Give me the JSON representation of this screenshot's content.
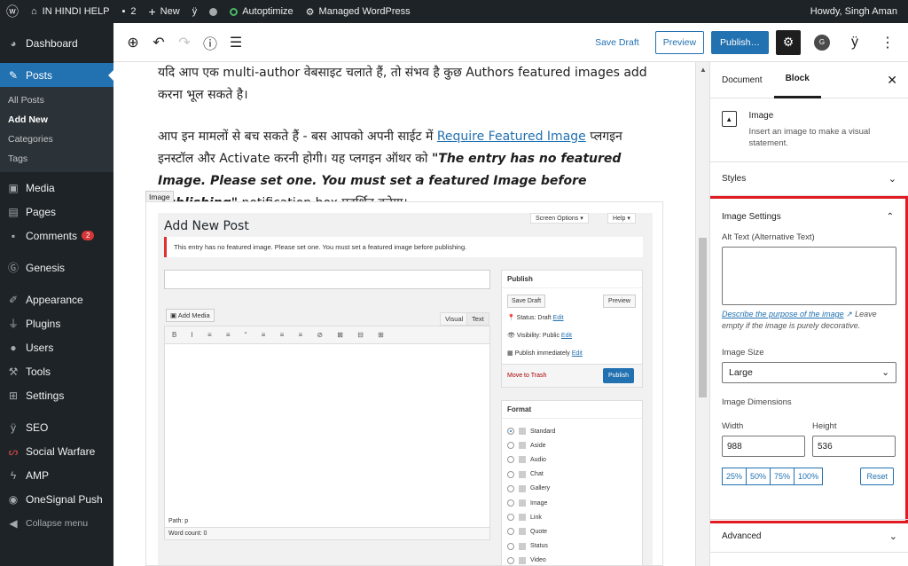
{
  "adminbar": {
    "site_name": "IN HINDI HELP",
    "comments_count": "2",
    "new_label": "New",
    "autoptimize": "Autoptimize",
    "managed": "Managed WordPress",
    "howdy": "Howdy, Singh Aman"
  },
  "sidebar": {
    "dashboard": "Dashboard",
    "posts": "Posts",
    "sub": [
      "All Posts",
      "Add New",
      "Categories",
      "Tags"
    ],
    "media": "Media",
    "pages": "Pages",
    "comments": "Comments",
    "comments_badge": "2",
    "genesis": "Genesis",
    "appearance": "Appearance",
    "plugins": "Plugins",
    "users": "Users",
    "tools": "Tools",
    "settings": "Settings",
    "seo": "SEO",
    "social_warfare": "Social Warfare",
    "amp": "AMP",
    "onesignal": "OneSignal Push",
    "collapse": "Collapse menu"
  },
  "toolbar": {
    "save_draft": "Save Draft",
    "preview": "Preview",
    "publish": "Publish…"
  },
  "editor": {
    "para1": "यदि आप एक multi-author वेबसाइट चलाते हैं, तो संभव है कुछ Authors featured images add करना भूल सकते है।",
    "para2_a": "आप इन मामलों से बच सकते हैं - बस आपको अपनी साईट में ",
    "para2_link": "Require Featured Image",
    "para2_b": " प्लगइन इनस्टॉल और Activate करनी होगी। यह प्लगइन ऑथर को ",
    "para2_quote": "\"The entry has no featured Image. Please set one. You must set a featured Image before publishing\"",
    "para2_c": " notification box प्रदर्शित करेगा।",
    "image_label": "Image"
  },
  "screenshot": {
    "title": "Add New Post",
    "screen_options": "Screen Options",
    "help": "Help",
    "notice": "This entry has no featured image. Please set one. You must set a featured image before publishing.",
    "add_media": "Add Media",
    "visual": "Visual",
    "text": "Text",
    "path": "Path: p",
    "word_count": "Word count: 0",
    "publish_box": "Publish",
    "save_draft": "Save Draft",
    "preview": "Preview",
    "status": "Status: Draft",
    "visibility": "Visibility: Public",
    "publish_immediately": "Publish immediately",
    "edit": "Edit",
    "move_to_trash": "Move to Trash",
    "publish_btn": "Publish",
    "format_box": "Format",
    "formats": [
      "Standard",
      "Aside",
      "Audio",
      "Chat",
      "Gallery",
      "Image",
      "Link",
      "Quote",
      "Status",
      "Video"
    ]
  },
  "panel": {
    "tab_document": "Document",
    "tab_block": "Block",
    "block_title": "Image",
    "block_desc": "Insert an image to make a visual statement.",
    "styles": "Styles",
    "image_settings": "Image Settings",
    "alt_label": "Alt Text (Alternative Text)",
    "help_link": "Describe the purpose of the image",
    "help_rest": " Leave empty if the image is purely decorative.",
    "size_label": "Image Size",
    "size_value": "Large",
    "dims_label": "Image Dimensions",
    "width_label": "Width",
    "height_label": "Height",
    "width_value": "988",
    "height_value": "536",
    "pcts": [
      "25%",
      "50%",
      "75%",
      "100%"
    ],
    "reset": "Reset",
    "advanced": "Advanced"
  },
  "colors": {
    "accent": "#2271b1",
    "highlight": "#e11b22",
    "admin_dark": "#1d2327"
  }
}
